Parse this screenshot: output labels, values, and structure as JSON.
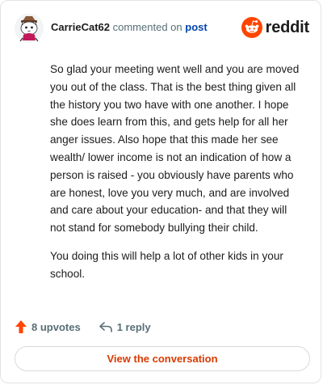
{
  "header": {
    "username": "CarrieCat62",
    "action_text": "commented on",
    "post_link": "post",
    "brand_word": "reddit"
  },
  "comment": {
    "paragraphs": [
      "So glad your meeting went well and you are moved you out of the class. That is the best thing given all the history you two have with one another. I hope she does learn from this, and gets help for all her anger issues. Also hope that this made her see wealth/ lower income is not an indication of how a person is raised - you obviously have parents who are honest, love you very much, and are involved and care about your education- and that they will not stand for somebody bullying their child.",
      "You doing this will help a lot of other kids in your school."
    ]
  },
  "actions": {
    "upvotes_label": "8 upvotes",
    "replies_label": "1 reply",
    "upvote_icon": "upvote-arrow-icon",
    "reply_icon": "reply-icon"
  },
  "cta": {
    "label": "View the conversation"
  },
  "colors": {
    "brand": "#ff4500",
    "link": "#0045ac",
    "cta_text": "#d93a00",
    "muted": "#576f76"
  }
}
